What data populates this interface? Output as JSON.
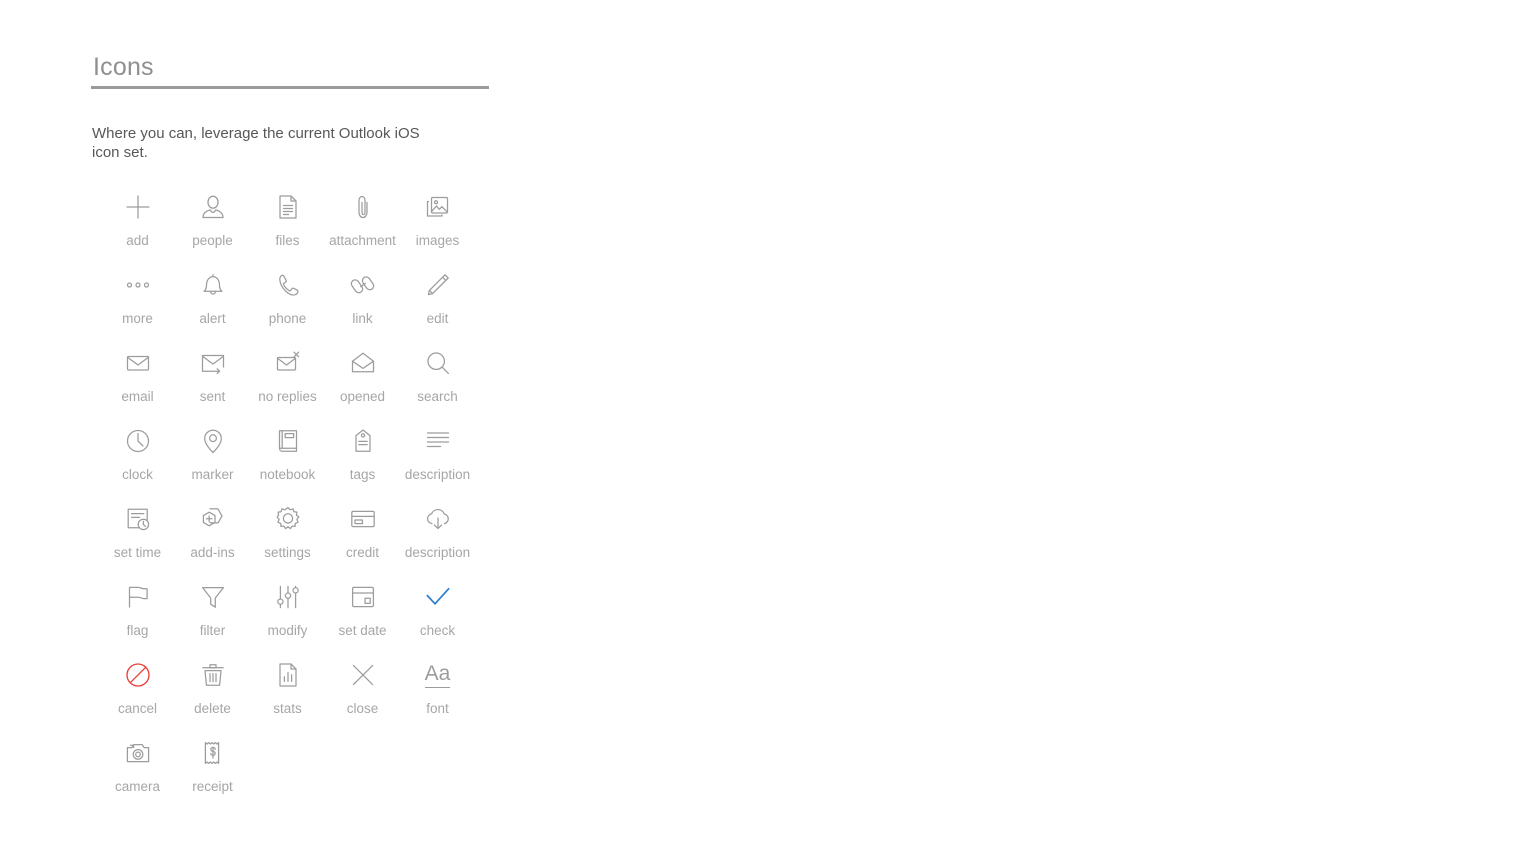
{
  "header": {
    "title": "Icons",
    "intro": "Where you can, leverage the current Outlook iOS icon set."
  },
  "colors": {
    "title": "#8f8f8f",
    "rule": "#9b9b9b",
    "body_text": "#575757",
    "icon_stroke": "#9c9c9c",
    "label": "#a6a6a6",
    "accent_blue": "#2f7fd1",
    "accent_red": "#e8403a"
  },
  "icons": [
    {
      "name": "add",
      "label": "add",
      "glyph": "plus-icon",
      "color": "#9c9c9c"
    },
    {
      "name": "people",
      "label": "people",
      "glyph": "person-icon",
      "color": "#9c9c9c"
    },
    {
      "name": "files",
      "label": "files",
      "glyph": "document-icon",
      "color": "#9c9c9c"
    },
    {
      "name": "attachment",
      "label": "attachment",
      "glyph": "paperclip-icon",
      "color": "#9c9c9c"
    },
    {
      "name": "images",
      "label": "images",
      "glyph": "photos-icon",
      "color": "#9c9c9c"
    },
    {
      "name": "more",
      "label": "more",
      "glyph": "ellipsis-icon",
      "color": "#9c9c9c"
    },
    {
      "name": "alert",
      "label": "alert",
      "glyph": "bell-icon",
      "color": "#9c9c9c"
    },
    {
      "name": "phone",
      "label": "phone",
      "glyph": "phone-icon",
      "color": "#9c9c9c"
    },
    {
      "name": "link",
      "label": "link",
      "glyph": "link-icon",
      "color": "#9c9c9c"
    },
    {
      "name": "edit",
      "label": "edit",
      "glyph": "pencil-icon",
      "color": "#9c9c9c"
    },
    {
      "name": "email",
      "label": "email",
      "glyph": "envelope-icon",
      "color": "#9c9c9c"
    },
    {
      "name": "sent",
      "label": "sent",
      "glyph": "envelope-arrow-icon",
      "color": "#9c9c9c"
    },
    {
      "name": "no-replies",
      "label": "no replies",
      "glyph": "envelope-x-icon",
      "color": "#9c9c9c"
    },
    {
      "name": "opened",
      "label": "opened",
      "glyph": "envelope-open-icon",
      "color": "#9c9c9c"
    },
    {
      "name": "search",
      "label": "search",
      "glyph": "magnifier-icon",
      "color": "#9c9c9c"
    },
    {
      "name": "clock",
      "label": "clock",
      "glyph": "clock-icon",
      "color": "#9c9c9c"
    },
    {
      "name": "marker",
      "label": "marker",
      "glyph": "map-pin-icon",
      "color": "#9c9c9c"
    },
    {
      "name": "notebook",
      "label": "notebook",
      "glyph": "notebook-icon",
      "color": "#9c9c9c"
    },
    {
      "name": "tags",
      "label": "tags",
      "glyph": "tag-icon",
      "color": "#9c9c9c"
    },
    {
      "name": "description",
      "label": "description",
      "glyph": "text-lines-icon",
      "color": "#9c9c9c"
    },
    {
      "name": "set-time",
      "label": "set time",
      "glyph": "card-clock-icon",
      "color": "#9c9c9c"
    },
    {
      "name": "add-ins",
      "label": "add-ins",
      "glyph": "hexagon-plus-icon",
      "color": "#9c9c9c"
    },
    {
      "name": "settings",
      "label": "settings",
      "glyph": "gear-icon",
      "color": "#9c9c9c"
    },
    {
      "name": "credit",
      "label": "credit",
      "glyph": "credit-card-icon",
      "color": "#9c9c9c"
    },
    {
      "name": "description-cloud",
      "label": "description",
      "glyph": "cloud-download-icon",
      "color": "#9c9c9c"
    },
    {
      "name": "flag",
      "label": "flag",
      "glyph": "flag-icon",
      "color": "#9c9c9c"
    },
    {
      "name": "filter",
      "label": "filter",
      "glyph": "funnel-icon",
      "color": "#9c9c9c"
    },
    {
      "name": "modify",
      "label": "modify",
      "glyph": "sliders-icon",
      "color": "#9c9c9c"
    },
    {
      "name": "set-date",
      "label": "set date",
      "glyph": "calendar-icon",
      "color": "#9c9c9c"
    },
    {
      "name": "check",
      "label": "check",
      "glyph": "checkmark-icon",
      "color": "#2f7fd1"
    },
    {
      "name": "cancel",
      "label": "cancel",
      "glyph": "prohibited-icon",
      "color": "#e8403a"
    },
    {
      "name": "delete",
      "label": "delete",
      "glyph": "trash-icon",
      "color": "#9c9c9c"
    },
    {
      "name": "stats",
      "label": "stats",
      "glyph": "chart-document-icon",
      "color": "#9c9c9c"
    },
    {
      "name": "close",
      "label": "close",
      "glyph": "close-x-icon",
      "color": "#9c9c9c"
    },
    {
      "name": "font",
      "label": "font",
      "glyph": "font-aa-icon",
      "color": "#9c9c9c",
      "text": "Aa"
    },
    {
      "name": "camera",
      "label": "camera",
      "glyph": "camera-icon",
      "color": "#9c9c9c"
    },
    {
      "name": "receipt",
      "label": "receipt",
      "glyph": "receipt-icon",
      "color": "#9c9c9c"
    }
  ]
}
